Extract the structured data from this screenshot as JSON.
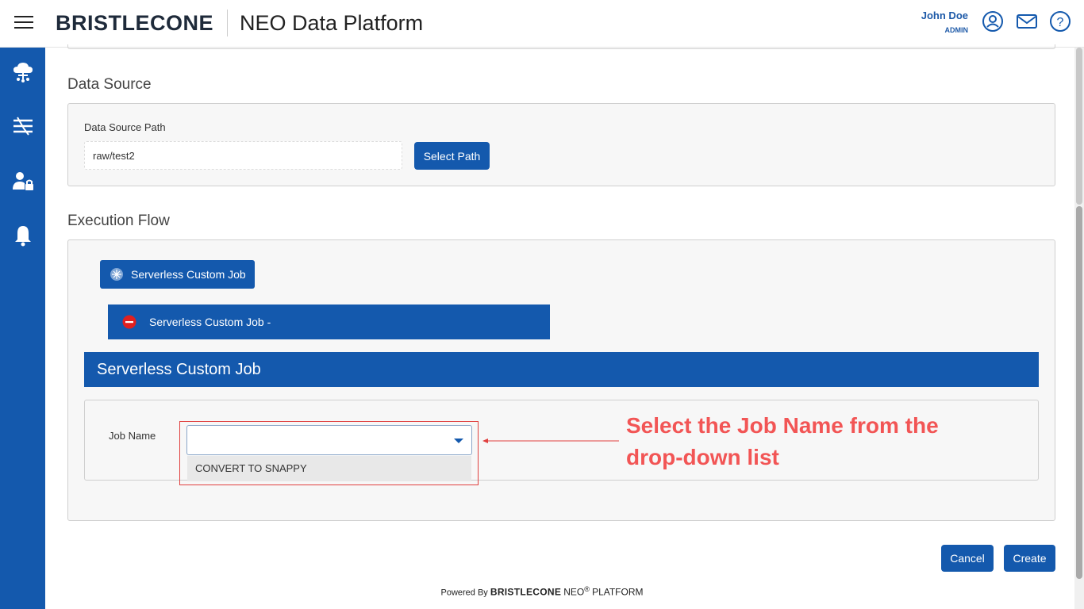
{
  "header": {
    "logo": "BRISTLECONE",
    "title": "NEO Data Platform",
    "user_name": "John Doe",
    "user_role": "ADMIN",
    "icons": [
      "account-circle-icon",
      "mail-icon",
      "help-circle-icon"
    ]
  },
  "sidebar": {
    "items": [
      "cloud-network-icon",
      "data-flow-icon",
      "user-lock-icon",
      "bell-icon"
    ]
  },
  "data_source": {
    "section_title": "Data Source",
    "path_label": "Data Source Path",
    "path_value": "raw/test2",
    "select_path_label": "Select Path"
  },
  "execution_flow": {
    "section_title": "Execution Flow",
    "job_chip_label": "Serverless Custom Job",
    "job_step_label": "Serverless Custom Job -",
    "job_panel_title": "Serverless Custom Job",
    "job_name_label": "Job Name",
    "job_name_value": "",
    "dropdown_options": [
      "CONVERT TO SNAPPY"
    ]
  },
  "annotation": {
    "line1": "Select the Job Name from the",
    "line2": "drop-down list",
    "color": "#f25555"
  },
  "actions": {
    "cancel_label": "Cancel",
    "create_label": "Create"
  },
  "footer": {
    "powered_by": "Powered By",
    "brand": "BRISTLECONE",
    "neo": "NEO",
    "reg": "®",
    "platform": "PLATFORM"
  },
  "colors": {
    "brand_blue": "#1459ad",
    "annotation_red": "#f25555"
  }
}
